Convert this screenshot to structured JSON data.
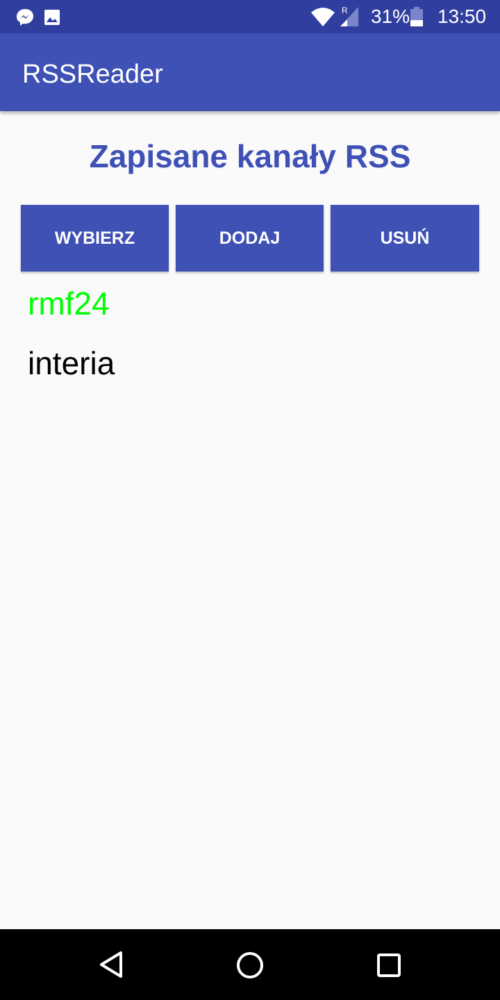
{
  "status_bar": {
    "icons": [
      "messenger-icon",
      "image-icon",
      "wifi-icon",
      "signal-roaming-icon",
      "battery-icon"
    ],
    "roaming": "R",
    "battery": "31%",
    "time": "13:50"
  },
  "app_bar": {
    "title": "RSSReader"
  },
  "main": {
    "heading": "Zapisane kanały RSS",
    "buttons": {
      "select": "WYBIERZ",
      "add": "DODAJ",
      "remove": "USUŃ"
    },
    "feeds": [
      {
        "name": "rmf24",
        "color": "#00ff00",
        "selected": true
      },
      {
        "name": "interia",
        "color": "#000000",
        "selected": false
      }
    ]
  },
  "colors": {
    "primary": "#3f51b5",
    "primary_dark": "#303f9f"
  }
}
